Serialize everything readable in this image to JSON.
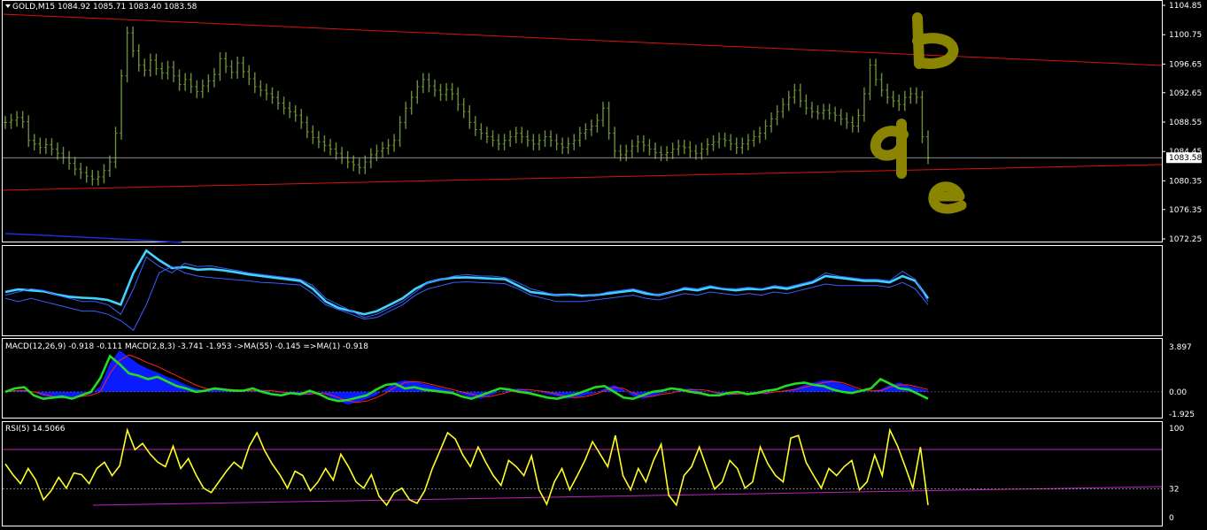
{
  "colors": {
    "background": "#000000",
    "panel_border": "#ffffff",
    "price_bars": "#6b8e3a",
    "trend_line": "#e01010",
    "annotation": "#8a8400",
    "ma_fast": "#3fd3ff",
    "band": "#3a5fff",
    "macd_hist": "#0a1cff",
    "macd_line": "#22dd22",
    "signal_line": "#ff2020",
    "rsi_line": "#ffff22",
    "rsi_levels": "#c020c0"
  },
  "chart_data": [
    {
      "type": "line",
      "panel": "price",
      "title": "GOLD,M15  1084.92 1085.71 1083.40 1083.58",
      "ylim": [
        1072.25,
        1104.85
      ],
      "y_ticks": [
        "1104.85",
        "1100.75",
        "1096.65",
        "1092.65",
        "1088.55",
        "1084.45",
        "1080.35",
        "1076.35",
        "1072.25"
      ],
      "current_price": "1083.58",
      "series": [
        {
          "values": [
            1088.5,
            1088.8,
            1089.2,
            1088.6,
            1086.0,
            1085.5,
            1085.0,
            1085.4,
            1084.8,
            1084.2,
            1083.6,
            1082.8,
            1082.0,
            1081.5,
            1081.0,
            1080.6,
            1080.9,
            1081.8,
            1083.0,
            1087.0,
            1095.0,
            1101.0,
            1098.5,
            1096.5,
            1095.8,
            1097.2,
            1096.0,
            1095.4,
            1096.2,
            1095.0,
            1093.8,
            1094.5,
            1093.5,
            1092.8,
            1093.6,
            1094.3,
            1095.2,
            1097.4,
            1096.3,
            1095.5,
            1096.8,
            1095.6,
            1094.6,
            1093.5,
            1093.0,
            1092.5,
            1092.0,
            1091.2,
            1090.5,
            1090.0,
            1089.5,
            1088.5,
            1087.2,
            1086.4,
            1085.8,
            1085.3,
            1084.8,
            1084.2,
            1083.6,
            1083.0,
            1082.6,
            1082.2,
            1083.0,
            1084.0,
            1084.5,
            1084.9,
            1085.3,
            1086.0,
            1088.5,
            1090.5,
            1092.0,
            1093.5,
            1094.5,
            1093.6,
            1093.0,
            1092.4,
            1093.1,
            1092.5,
            1091.0,
            1090.0,
            1088.5,
            1087.5,
            1087.0,
            1086.5,
            1086.0,
            1085.5,
            1086.0,
            1086.5,
            1087.0,
            1086.5,
            1086.0,
            1085.5,
            1086.0,
            1086.5,
            1086.0,
            1085.5,
            1085.0,
            1085.5,
            1086.0,
            1087.0,
            1087.5,
            1088.0,
            1088.8,
            1090.5,
            1087.0,
            1084.5,
            1084.0,
            1084.5,
            1085.2,
            1085.8,
            1085.3,
            1084.8,
            1084.3,
            1084.0,
            1084.3,
            1084.8,
            1085.2,
            1085.0,
            1084.5,
            1084.2,
            1084.8,
            1085.4,
            1085.8,
            1086.2,
            1086.0,
            1085.5,
            1085.0,
            1085.5,
            1086.0,
            1086.5,
            1087.0,
            1088.0,
            1089.0,
            1090.0,
            1091.0,
            1092.0,
            1093.0,
            1091.5,
            1090.5,
            1090.0,
            1089.8,
            1090.2,
            1089.8,
            1089.5,
            1089.0,
            1088.5,
            1088.0,
            1089.5,
            1092.5,
            1096.5,
            1094.5,
            1093.0,
            1092.0,
            1091.5,
            1091.0,
            1092.0,
            1092.5,
            1092.0,
            1086.5,
            1083.58
          ]
        }
      ]
    },
    {
      "type": "line",
      "panel": "moving-average-envelope",
      "series": [
        {
          "values": [
            0,
            0.8,
            0.5,
            0.2,
            -0.8,
            -1.5,
            -1.8,
            -2.0,
            -2.5,
            -4,
            6,
            13,
            10,
            7.5,
            7.8,
            7,
            7.2,
            6.8,
            6.2,
            5.5,
            5,
            4.5,
            4,
            3.5,
            1,
            -3,
            -5,
            -6,
            -7,
            -6,
            -4,
            -2,
            1,
            3,
            4,
            4.5,
            4.6,
            4.4,
            4.2,
            4,
            2,
            0,
            -0.5,
            -1,
            -0.8,
            -1.2,
            -1,
            -0.5,
            0,
            0.5,
            -0.5,
            -1,
            0,
            1,
            0.5,
            1.5,
            1,
            0.5,
            1,
            0.8,
            1.5,
            1,
            2,
            3,
            5,
            4.5,
            4,
            3.5,
            3.5,
            3,
            5,
            3.5,
            -2
          ]
        },
        {
          "values": [
            -1,
            0,
            1,
            0.5,
            -1,
            -2,
            -3,
            -3,
            -4,
            -7,
            1,
            11,
            8,
            6,
            9,
            8,
            8.2,
            7.5,
            6.8,
            6,
            5.5,
            5,
            4.5,
            4,
            2,
            -2,
            -4,
            -6,
            -8,
            -7,
            -5,
            -3,
            0,
            3,
            4,
            5,
            5.5,
            5,
            5,
            4.5,
            3,
            1,
            0,
            -1,
            -1,
            -1.5,
            -1,
            0,
            0.5,
            1,
            0,
            -1,
            0,
            1.5,
            1,
            2,
            1.2,
            1,
            1.5,
            1,
            2,
            1.5,
            2.5,
            3.5,
            6,
            5,
            4.5,
            4,
            4,
            3.5,
            6.5,
            4,
            -3
          ]
        },
        {
          "values": [
            -2,
            -3,
            -2,
            -3,
            -4,
            -5,
            -6,
            -6,
            -7,
            -9,
            -12,
            -4,
            6,
            8,
            6,
            5,
            4.5,
            4.2,
            3.8,
            3.5,
            3,
            2.8,
            2.5,
            2.2,
            -0.5,
            -4,
            -5.5,
            -7,
            -8.5,
            -8,
            -6,
            -4,
            -1,
            1,
            2,
            3,
            3.2,
            3,
            2.8,
            2.6,
            1,
            -1,
            -2,
            -3,
            -3,
            -3,
            -2.5,
            -2,
            -1.5,
            -1,
            -2,
            -2.5,
            -1.5,
            -0.5,
            -1,
            0,
            -0.5,
            -1,
            -0.5,
            -1,
            0,
            -0.5,
            0.5,
            1.5,
            2.5,
            2,
            2,
            2,
            2,
            1.5,
            3,
            1,
            -4
          ]
        }
      ]
    },
    {
      "type": "area",
      "panel": "macd",
      "title": "MACD(12,26,9) -0.918 -0.111  MACD(2,8,3) -3.741 -1.953  ->MA(55) -0.145  =>MA(1) -0.918",
      "ylim": [
        -1.925,
        3.897
      ],
      "y_ticks": [
        "3.897",
        "0.00",
        "-1.925"
      ],
      "series": [
        {
          "values": [
            0,
            0.1,
            0.2,
            0,
            -0.4,
            -0.5,
            -0.6,
            -0.5,
            -0.3,
            -0.2,
            0.5,
            2.5,
            3.6,
            3.0,
            2.4,
            2.0,
            1.7,
            1.3,
            1.0,
            0.6,
            0.3,
            0.1,
            0.2,
            0.3,
            0.2,
            0,
            0.1,
            0.2,
            0,
            -0.1,
            -0.2,
            -0.3,
            -0.2,
            0,
            -0.4,
            -0.8,
            -1.1,
            -0.9,
            -0.6,
            -0.3,
            0.3,
            0.8,
            1.0,
            0.9,
            0.7,
            0.5,
            0.3,
            0.1,
            -0.2,
            -0.5,
            -0.6,
            -0.3,
            0,
            0.2,
            0.3,
            0.1,
            0,
            -0.2,
            -0.4,
            -0.6,
            -0.5,
            -0.3,
            -0.1,
            0.3,
            0.6,
            0.2,
            -0.4,
            -0.6,
            -0.4,
            -0.1,
            0,
            0.2,
            0.3,
            0.1,
            0,
            -0.2,
            -0.3,
            -0.2,
            0,
            -0.1,
            -0.2,
            0,
            0.1,
            0.3,
            0.6,
            0.8,
            1.0,
            1.0,
            0.7,
            0.4,
            0.1,
            0,
            0.2,
            0.6,
            0.8,
            0.5,
            0.3,
            0.1
          ]
        },
        {
          "values": [
            0,
            0.1,
            0.1,
            0,
            -0.2,
            -0.4,
            -0.5,
            -0.5,
            -0.4,
            -0.3,
            0,
            1.6,
            2.7,
            3.2,
            2.9,
            2.5,
            2.2,
            1.8,
            1.4,
            1.0,
            0.6,
            0.3,
            0.2,
            0.2,
            0.2,
            0.1,
            0.1,
            0.1,
            0.1,
            0,
            -0.1,
            -0.2,
            -0.2,
            -0.1,
            -0.2,
            -0.5,
            -0.8,
            -0.9,
            -0.8,
            -0.5,
            -0.1,
            0.4,
            0.8,
            0.9,
            0.8,
            0.6,
            0.4,
            0.2,
            0,
            -0.2,
            -0.4,
            -0.4,
            -0.2,
            0,
            0.2,
            0.2,
            0.1,
            0,
            -0.2,
            -0.4,
            -0.5,
            -0.4,
            -0.2,
            0.1,
            0.4,
            0.3,
            -0.1,
            -0.4,
            -0.4,
            -0.2,
            -0.1,
            0.1,
            0.2,
            0.2,
            0.1,
            -0.1,
            -0.2,
            -0.2,
            -0.1,
            -0.1,
            -0.1,
            0,
            0.1,
            0.2,
            0.4,
            0.6,
            0.8,
            0.9,
            0.8,
            0.5,
            0.2,
            0.1,
            0.1,
            0.4,
            0.6,
            0.6,
            0.4,
            0.2
          ]
        },
        {
          "values": [
            0,
            0.3,
            0.4,
            -0.3,
            -0.6,
            -0.5,
            -0.4,
            -0.6,
            -0.3,
            0,
            1.2,
            3.1,
            2.4,
            1.6,
            1.4,
            1.1,
            1.3,
            0.9,
            0.5,
            0.3,
            0,
            0.1,
            0.3,
            0.2,
            0.1,
            0.1,
            0.3,
            0,
            -0.2,
            -0.3,
            -0.1,
            -0.2,
            0.1,
            -0.2,
            -0.6,
            -0.8,
            -0.7,
            -0.5,
            -0.3,
            0.2,
            0.6,
            0.7,
            0.3,
            0.4,
            0.2,
            0.1,
            0,
            -0.1,
            -0.4,
            -0.6,
            -0.3,
            0,
            0.3,
            0.2,
            0,
            -0.1,
            -0.3,
            -0.5,
            -0.6,
            -0.4,
            -0.2,
            0.1,
            0.4,
            0.5,
            0,
            -0.5,
            -0.6,
            -0.3,
            0,
            0.1,
            0.3,
            0.2,
            0,
            -0.1,
            -0.3,
            -0.3,
            -0.1,
            0,
            -0.2,
            -0.1,
            0.1,
            0.2,
            0.5,
            0.7,
            0.8,
            0.6,
            0.5,
            0.2,
            0,
            -0.1,
            0.1,
            0.3,
            1.1,
            0.7,
            0.3,
            0.2,
            -0.2,
            -0.6
          ]
        }
      ]
    },
    {
      "type": "line",
      "panel": "rsi",
      "title": "RSI(5) 14.5066",
      "ylim": [
        0,
        100
      ],
      "y_ticks": [
        "100",
        "32",
        "0"
      ],
      "series": [
        {
          "values": [
            60,
            48,
            38,
            55,
            42,
            20,
            30,
            45,
            33,
            50,
            48,
            38,
            55,
            62,
            47,
            58,
            98,
            76,
            83,
            71,
            62,
            57,
            80,
            55,
            66,
            48,
            33,
            28,
            40,
            52,
            62,
            55,
            80,
            95,
            75,
            60,
            48,
            33,
            52,
            47,
            30,
            40,
            55,
            42,
            71,
            57,
            40,
            33,
            48,
            24,
            14,
            28,
            33,
            20,
            16,
            30,
            55,
            75,
            95,
            88,
            70,
            57,
            79,
            62,
            47,
            36,
            64,
            57,
            47,
            69,
            31,
            15,
            40,
            55,
            31,
            47,
            64,
            85,
            71,
            57,
            92,
            47,
            31,
            55,
            40,
            64,
            82,
            25,
            14,
            47,
            57,
            79,
            55,
            32,
            40,
            64,
            55,
            33,
            40,
            79,
            60,
            47,
            40,
            89,
            92,
            62,
            47,
            33,
            55,
            47,
            57,
            64,
            31,
            40,
            70,
            47,
            98,
            80,
            57,
            33,
            79,
            14
          ]
        }
      ]
    }
  ]
}
